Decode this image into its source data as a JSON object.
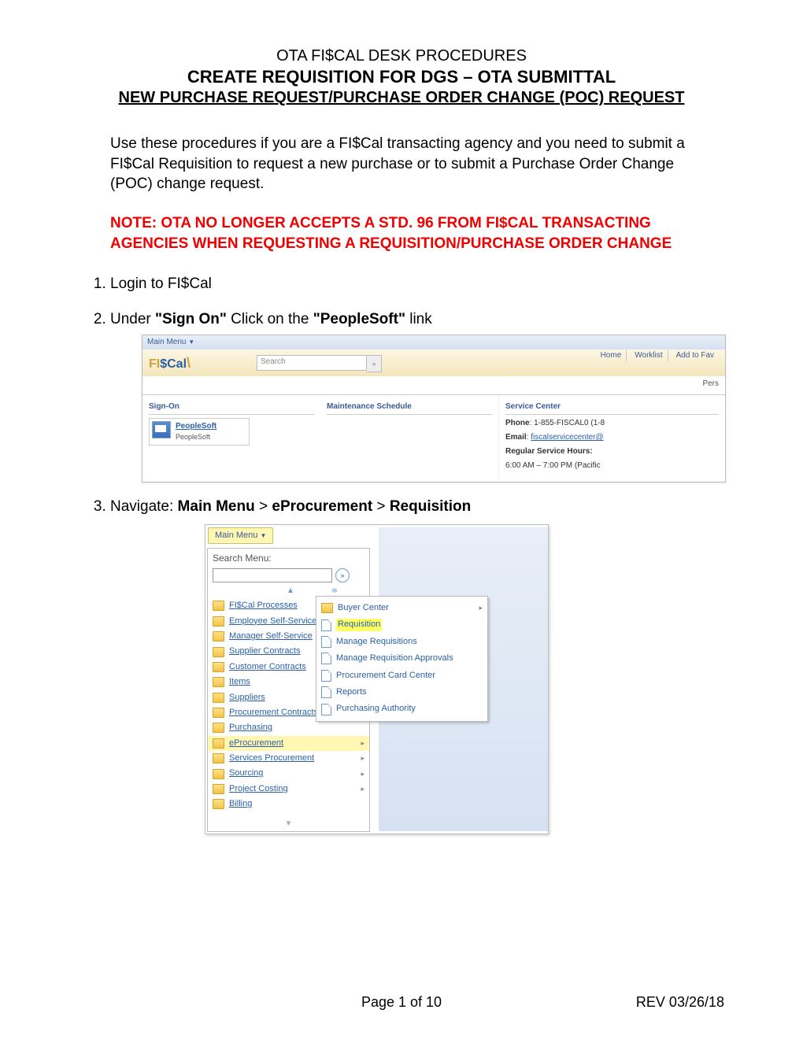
{
  "header": {
    "line1": "OTA FI$CAL DESK PROCEDURES",
    "line2": "CREATE REQUISITION FOR DGS – OTA SUBMITTAL",
    "line3": "NEW PURCHASE REQUEST/PURCHASE ORDER CHANGE (POC) REQUEST"
  },
  "intro": "Use these procedures if you are a FI$Cal transacting agency and you need to submit a FI$Cal Requisition to request a new purchase or to submit a Purchase Order Change (POC) change request.",
  "note": "NOTE: OTA NO LONGER ACCEPTS A STD. 96 FROM FI$CAL TRANSACTING AGENCIES WHEN REQUESTING A REQUISITION/PURCHASE ORDER CHANGE",
  "steps": {
    "s1": "Login to FI$Cal",
    "s2_pre": "Under ",
    "s2_b1": "\"Sign On\"",
    "s2_mid": " Click on the ",
    "s2_b2": "\"PeopleSoft\"",
    "s2_post": " link",
    "s3_pre": "Navigate: ",
    "s3_b1": "Main Menu",
    "s3_sep": " > ",
    "s3_b2": "eProcurement",
    "s3_b3": "Requisition"
  },
  "shot1": {
    "main_menu": "Main Menu",
    "logo_fi": "FI",
    "logo_s": "$",
    "logo_cal": "Cal",
    "logo_swoosh": "\\",
    "search_placeholder": "Search",
    "nav_home": "Home",
    "nav_worklist": "Worklist",
    "nav_addfav": "Add to Fav",
    "tab_pers": "Pers",
    "col1_h": "Sign-On",
    "ps_bold": "PeopleSoft",
    "ps_sub": "PeopleSoft",
    "col2_h": "Maintenance Schedule",
    "col3_h": "Service Center",
    "phone_l": "Phone",
    "phone_v": ": 1-855-FISCAL0 (1-8",
    "email_l": "Email",
    "email_v": "fiscalservicecenter@",
    "hours_l": "Regular Service Hours:",
    "hours_v": "6:00 AM – 7:00 PM (Pacific"
  },
  "shot2": {
    "main_menu": "Main Menu",
    "search_menu": "Search Menu:",
    "items": [
      "FI$Cal Processes",
      "Employee Self-Service",
      "Manager Self-Service",
      "Supplier Contracts",
      "Customer Contracts",
      "Items",
      "Suppliers",
      "Procurement Contracts",
      "Purchasing",
      "eProcurement",
      "Services Procurement",
      "Sourcing",
      "Project Costing",
      "Billing"
    ],
    "sub": [
      "Buyer Center",
      "Requisition",
      "Manage Requisitions",
      "Manage Requisition Approvals",
      "Procurement Card Center",
      "Reports",
      "Purchasing Authority"
    ]
  },
  "footer": {
    "page": "Page 1 of 10",
    "rev": "REV 03/26/18"
  }
}
